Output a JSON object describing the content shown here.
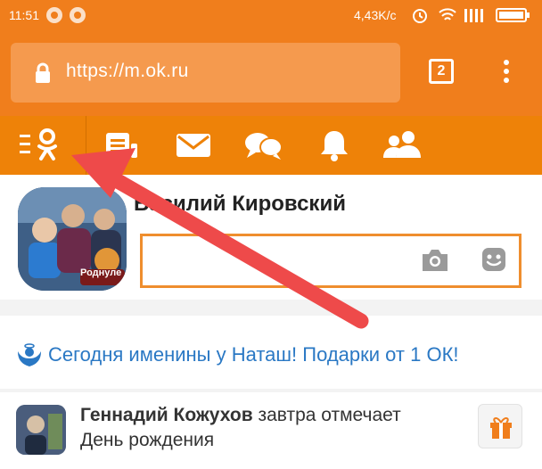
{
  "status_bar": {
    "time": "11:51",
    "network_speed": "4,43K/c",
    "icons": [
      "notification-icon",
      "notification-icon",
      "alarm-icon",
      "wifi-icon",
      "signal-icon",
      "battery-icon"
    ]
  },
  "browser": {
    "url": "https://m.ok.ru",
    "tab_count": "2",
    "icons": {
      "lock": "lock-icon",
      "menu": "more-vert-icon"
    }
  },
  "nav": {
    "items": [
      "menu-ok-icon",
      "feed-icon",
      "messages-icon",
      "discussions-icon",
      "notifications-icon",
      "friends-icon"
    ]
  },
  "profile": {
    "name": "Василий Кировский",
    "avatar_badge": "Роднуле"
  },
  "greeting": {
    "text": "Сегодня именины у Наташ! Подарки от 1 ОК!"
  },
  "feed": {
    "name": "Геннадий Кожухов",
    "action_line1": " завтра отмечает",
    "action_line2": "День рождения"
  },
  "colors": {
    "brand_orange": "#f07e1c",
    "nav_orange": "#ee8208",
    "link_blue": "#2a78c4",
    "arrow_red": "#ee4a4a"
  }
}
